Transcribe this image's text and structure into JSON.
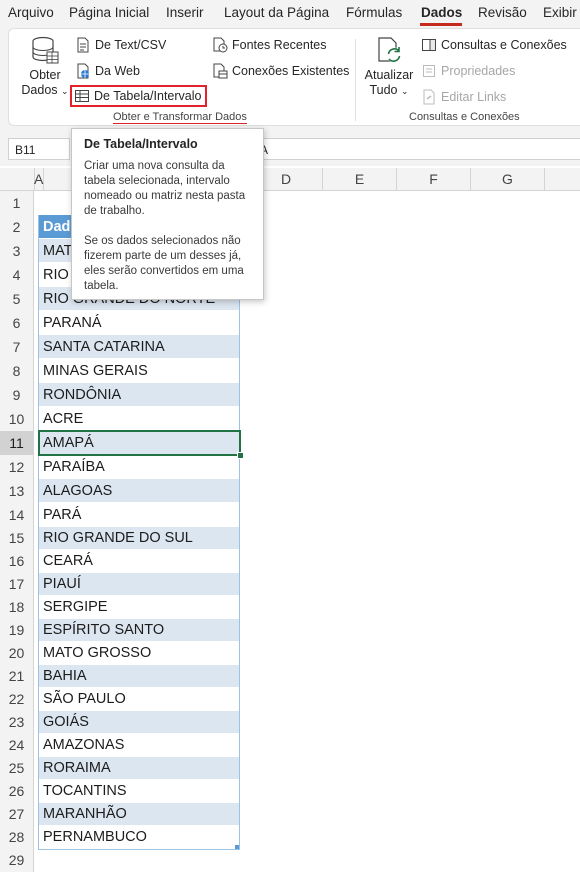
{
  "menu": [
    "Arquivo",
    "Página Inicial",
    "Inserir",
    "Layout da Página",
    "Fórmulas",
    "Dados",
    "Revisão",
    "Exibir"
  ],
  "active_tab": "Dados",
  "ribbon": {
    "get_data": {
      "line1": "Obter",
      "line2": "Dados"
    },
    "from_text_csv": "De Text/CSV",
    "from_web": "Da Web",
    "from_table_range": "De Tabela/Intervalo",
    "recent_sources": "Fontes Recentes",
    "existing_connections": "Conexões Existentes",
    "group_get_transform": "Obter e Transformar Dados",
    "refresh_all": {
      "line1": "Atualizar",
      "line2": "Tudo"
    },
    "queries_connections": "Consultas e Conexões",
    "properties": "Propriedades",
    "edit_links": "Editar Links",
    "group_queries": "Consultas e Conexões"
  },
  "formula_bar": {
    "name_box": "B11",
    "formula": "A"
  },
  "tooltip": {
    "title": "De Tabela/Intervalo",
    "body": "Criar uma nova consulta da tabela selecionada, intervalo nomeado ou matriz nesta pasta de trabalho.\n\nSe os dados selecionados não fizerem parte de um desses já, eles serão convertidos em uma tabela."
  },
  "columns": [
    "A",
    "",
    "D",
    "E",
    "F",
    "G"
  ],
  "rows": [
    "1",
    "2",
    "3",
    "4",
    "5",
    "6",
    "7",
    "8",
    "9",
    "10",
    "11",
    "12",
    "13",
    "14",
    "15",
    "16",
    "17",
    "18",
    "19",
    "20",
    "21",
    "22",
    "23",
    "24",
    "25",
    "26",
    "27",
    "28",
    "29"
  ],
  "selected_row": "11",
  "table_header": "Dados",
  "cells": [
    "MATO GROSSO DO SUL",
    "RIO DE JANEIRO",
    "RIO GRANDE DO NORTE",
    "PARANÁ",
    "SANTA CATARINA",
    "MINAS GERAIS",
    "RONDÔNIA",
    "ACRE",
    "AMAPÁ",
    "PARAÍBA",
    "ALAGOAS",
    "PARÁ",
    "RIO GRANDE DO SUL",
    "CEARÁ",
    "PIAUÍ",
    "SERGIPE",
    "ESPÍRITO SANTO",
    "MATO GROSSO",
    "BAHIA",
    "SÃO PAULO",
    "GOIÁS",
    "AMAZONAS",
    "RORAIMA",
    "TOCANTINS",
    "MARANHÃO",
    "PERNAMBUCO"
  ],
  "colors": {
    "accent_red": "#e3222b",
    "table_header": "#5b9bd5",
    "band": "#dce6f0",
    "selection": "#217346"
  }
}
